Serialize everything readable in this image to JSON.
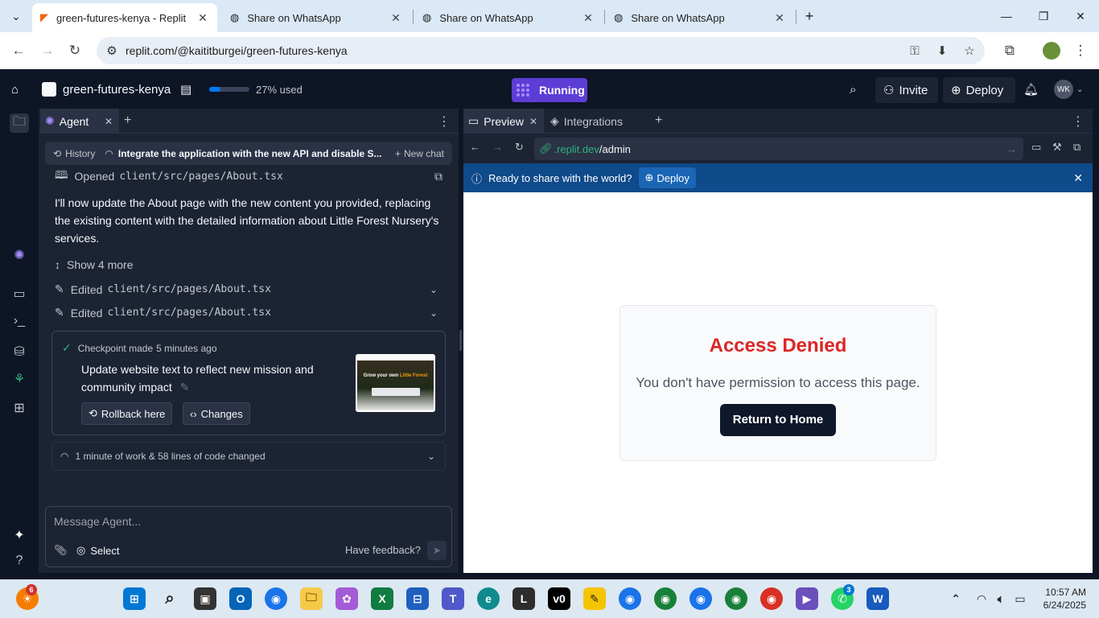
{
  "browser": {
    "tabs": [
      {
        "label": "green-futures-kenya - Replit",
        "active": true
      },
      {
        "label": "Share on WhatsApp",
        "active": false
      },
      {
        "label": "Share on WhatsApp",
        "active": false
      },
      {
        "label": "Share on WhatsApp",
        "active": false
      }
    ],
    "url": "replit.com/@kaititburgei/green-futures-kenya"
  },
  "replit": {
    "project_name": "green-futures-kenya",
    "usage_label": "27% used",
    "usage_fraction": 0.27,
    "run_status": "Running",
    "invite_label": "Invite",
    "deploy_label": "Deploy",
    "avatar_initials": "WK"
  },
  "agent": {
    "tab_label": "Agent",
    "history_label": "History",
    "chat_title": "Integrate the application with the new API and disable S...",
    "new_chat_label": "New chat",
    "opened_prefix": "Opened",
    "opened_file": "client/src/pages/About.tsx",
    "message": "I'll now update the About page with the new content you provided, replacing the existing content with the detailed information about Little Forest Nursery's services.",
    "show_more": "Show 4 more",
    "edits": [
      {
        "prefix": "Edited",
        "file": "client/src/pages/About.tsx"
      },
      {
        "prefix": "Edited",
        "file": "client/src/pages/About.tsx"
      }
    ],
    "checkpoint": {
      "label": "Checkpoint made",
      "time": "5 minutes ago",
      "title": "Update website text to reflect new mission and community impact",
      "rollback_label": "Rollback here",
      "changes_label": "Changes",
      "thumb_text_a": "Grow your own",
      "thumb_text_b": "Little Forest"
    },
    "work_summary": "1 minute of work & 58 lines of code changed",
    "composer_placeholder": "Message Agent...",
    "select_label": "Select",
    "feedback_label": "Have feedback?"
  },
  "preview": {
    "tabs": [
      {
        "label": "Preview"
      },
      {
        "label": "Integrations"
      }
    ],
    "url_host": ".replit.dev",
    "url_path": "/admin",
    "banner_text": "Ready to share with the world?",
    "banner_deploy": "Deploy",
    "page": {
      "title": "Access Denied",
      "message": "You don't have permission to access this page.",
      "button": "Return to Home"
    }
  },
  "taskbar": {
    "time": "10:57 AM",
    "date": "6/24/2025",
    "badges": {
      "widgets": "6",
      "whatsapp": "3"
    }
  }
}
